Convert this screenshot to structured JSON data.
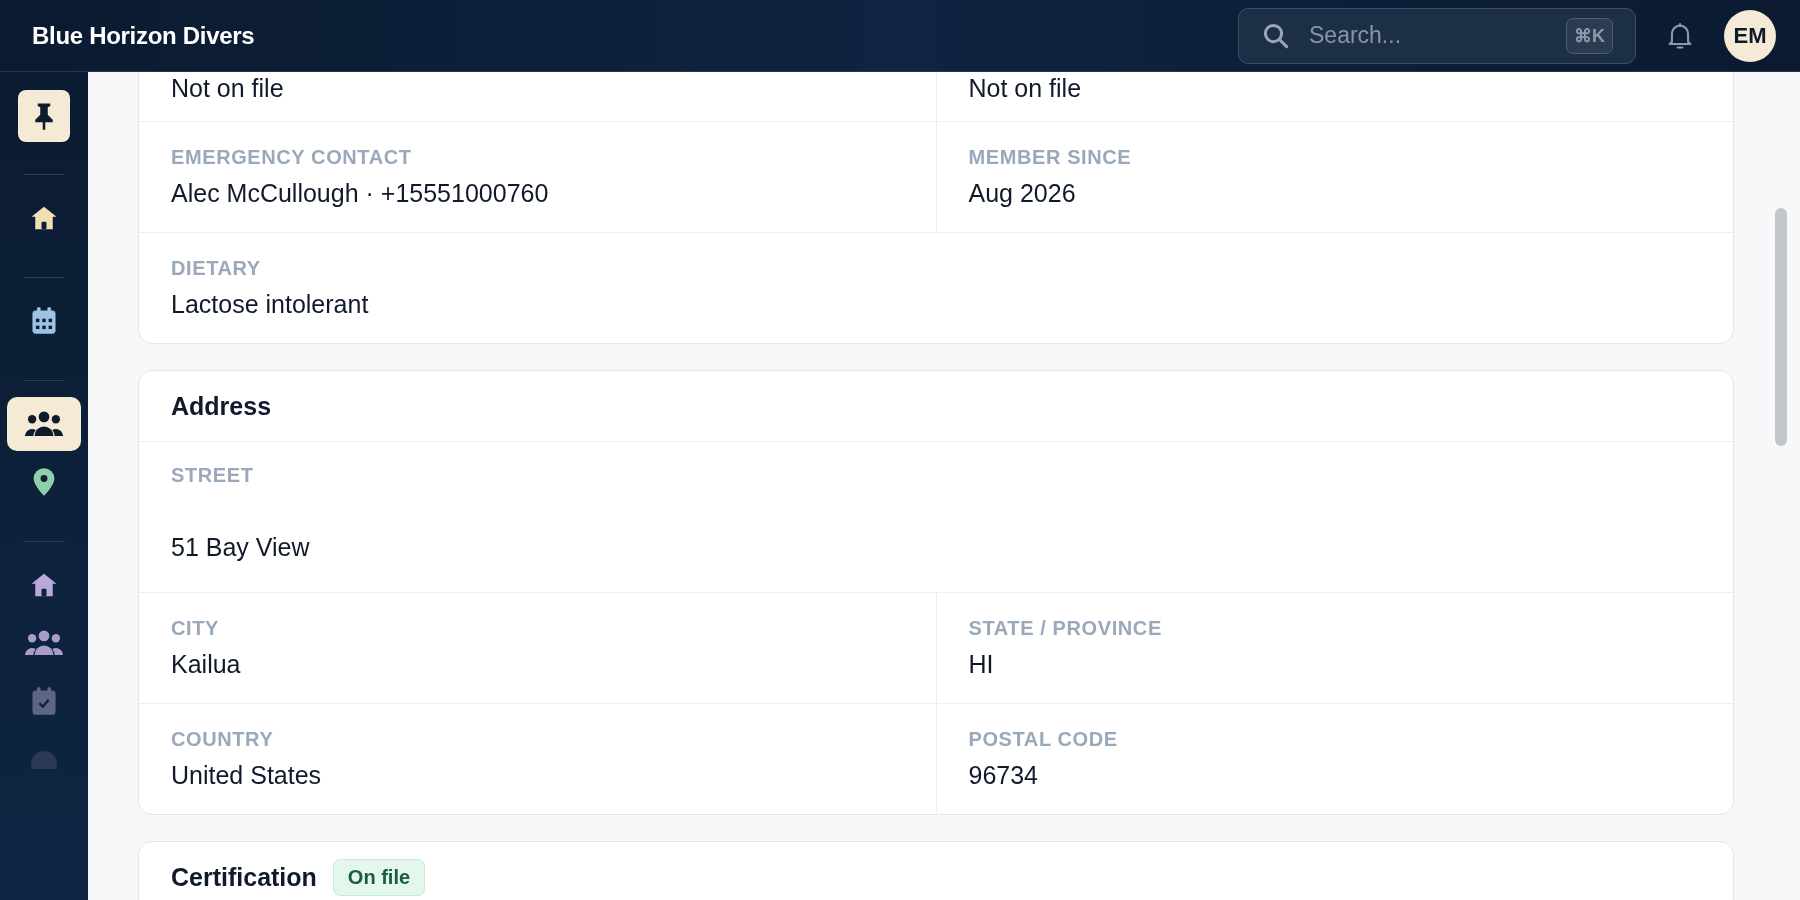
{
  "app": {
    "title": "Blue Horizon Divers"
  },
  "search": {
    "placeholder": "Search...",
    "shortcut": "⌘K"
  },
  "user": {
    "initials": "EM"
  },
  "sidebar": {
    "pin": {
      "on": true
    },
    "groups": [
      [
        {
          "kind": "home",
          "color": "#f2dfb4",
          "selected": false
        }
      ],
      [
        {
          "kind": "calendar",
          "color": "#9cc3e4",
          "selected": false
        }
      ],
      [
        {
          "kind": "people",
          "color": "#0f1b2d",
          "selected": true
        },
        {
          "kind": "location",
          "color": "#8fcfac",
          "selected": false
        }
      ],
      [
        {
          "kind": "home",
          "color": "#b9a9db",
          "selected": false
        },
        {
          "kind": "people",
          "color": "#a99cc9",
          "selected": false
        },
        {
          "kind": "task",
          "color": "#5f6585",
          "selected": false
        },
        {
          "kind": "circle",
          "color": "#2c3a55",
          "selected": false
        }
      ]
    ]
  },
  "sections": [
    {
      "rows": [
        [
          {
            "value": "Not on file"
          },
          {
            "value": "Not on file"
          }
        ],
        [
          {
            "label": "EMERGENCY CONTACT",
            "value": "Alec McCullough · +15551000760"
          },
          {
            "label": "MEMBER SINCE",
            "value": "Aug 2026"
          }
        ],
        [
          {
            "label": "DIETARY",
            "value": "Lactose intolerant"
          }
        ]
      ]
    },
    {
      "title": "Address",
      "rows": [
        [
          {
            "label": "STREET",
            "value": "51 Bay View",
            "kind": "multiline"
          }
        ],
        [
          {
            "label": "CITY",
            "value": "Kailua"
          },
          {
            "label": "STATE / PROVINCE",
            "value": "HI"
          }
        ],
        [
          {
            "label": "COUNTRY",
            "value": "United States"
          },
          {
            "label": "POSTAL CODE",
            "value": "96734"
          }
        ]
      ]
    },
    {
      "title": "Certification",
      "badge": "On file"
    }
  ]
}
